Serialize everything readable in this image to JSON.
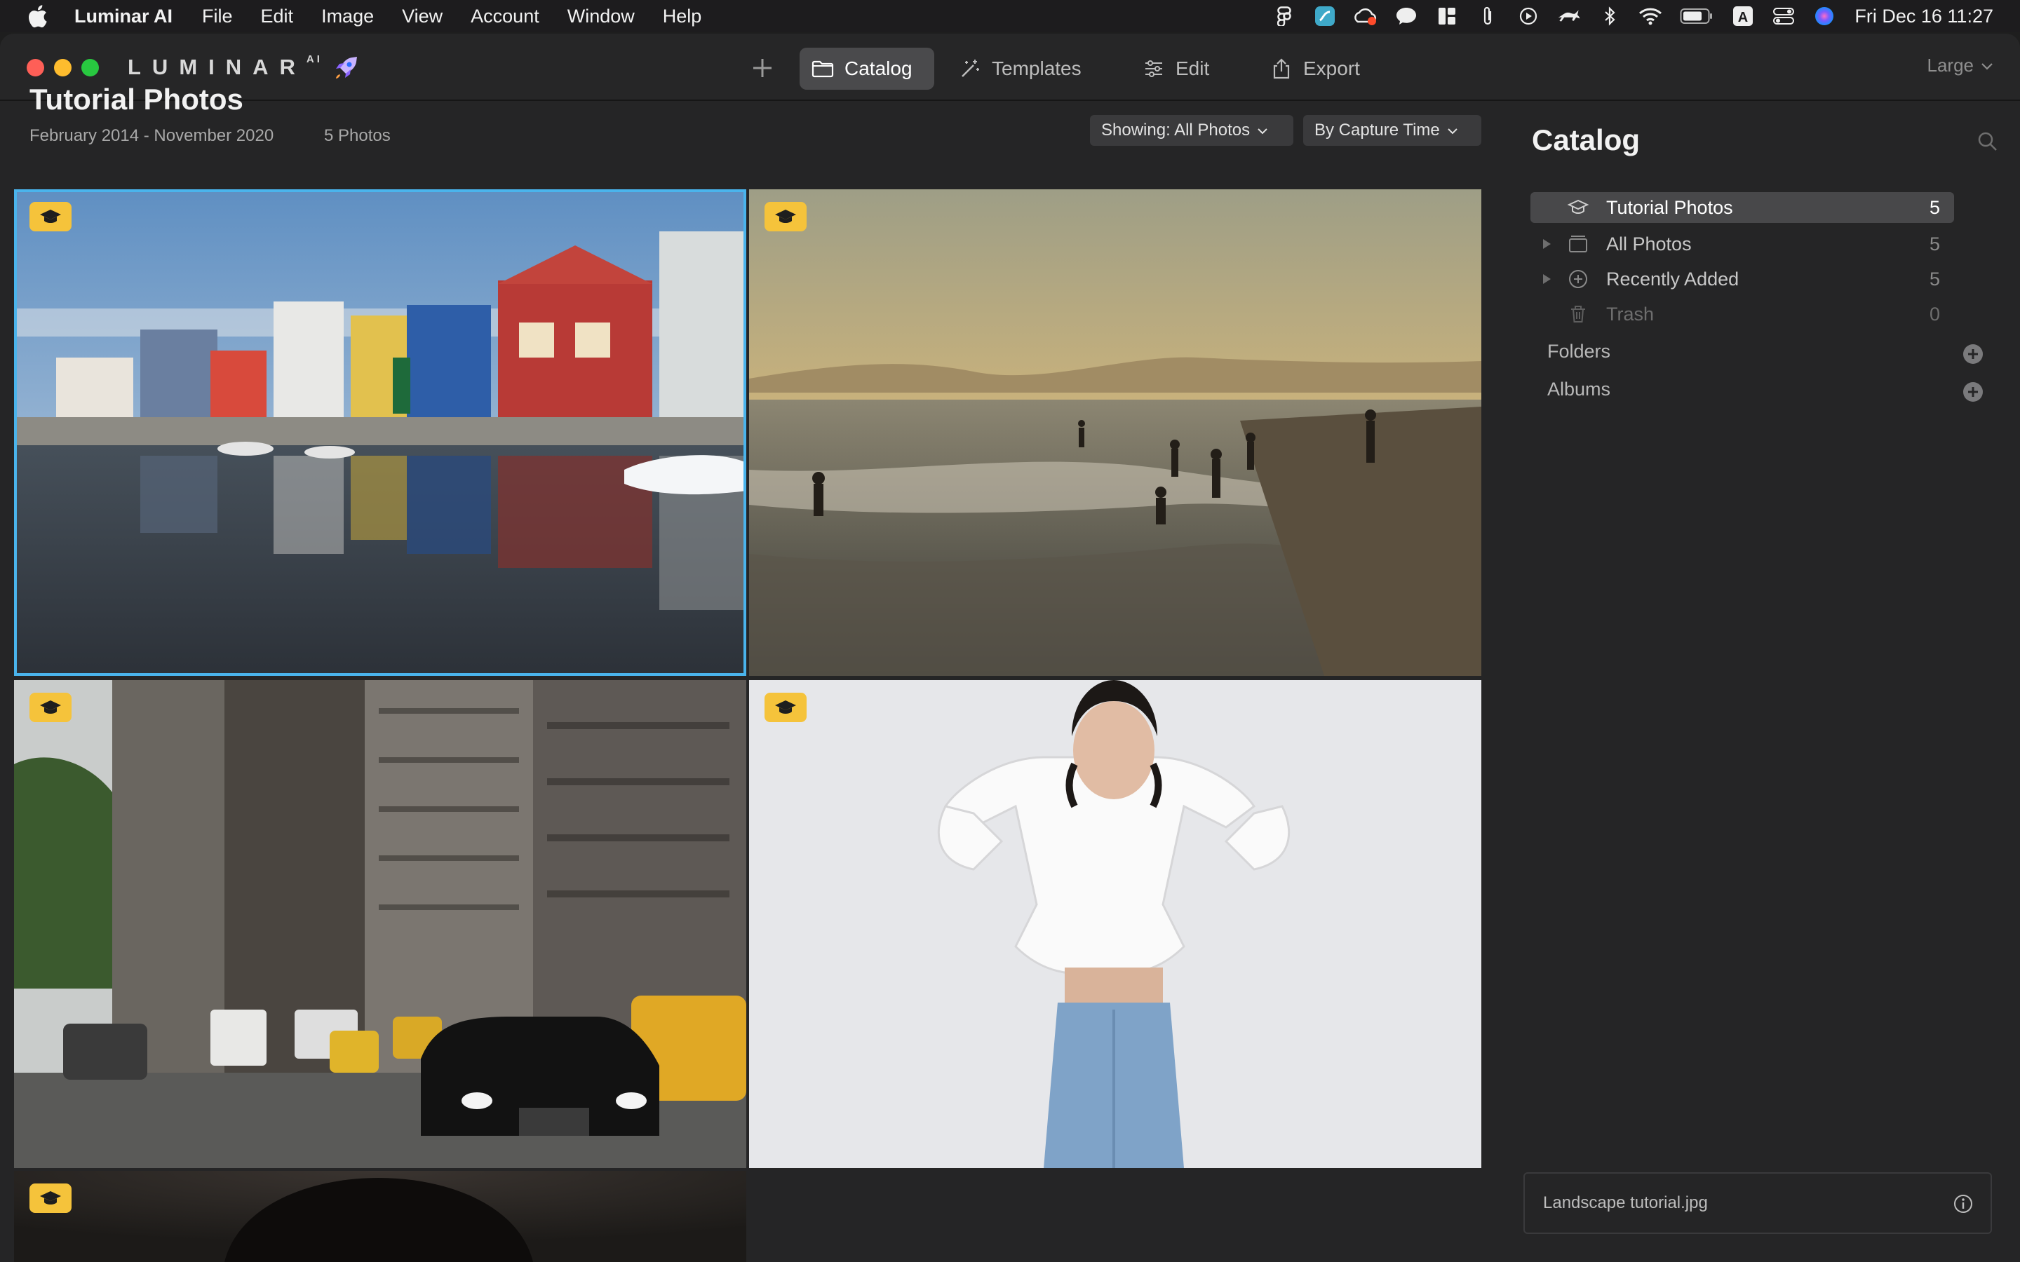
{
  "menubar": {
    "app_name": "Luminar AI",
    "menus": [
      "File",
      "Edit",
      "Image",
      "View",
      "Account",
      "Window",
      "Help"
    ],
    "clock": "Fri Dec 16  11:27",
    "keyboard_input": "A"
  },
  "toolbar": {
    "logo": "LUMINAR",
    "logo_sup": "AI",
    "tabs": {
      "catalog": "Catalog",
      "templates": "Templates",
      "edit": "Edit",
      "export": "Export"
    },
    "size": "Large"
  },
  "header": {
    "title": "Tutorial Photos",
    "date_range": "February 2014 - November 2020",
    "count": "5 Photos",
    "showing": "Showing: All Photos",
    "sort": "By Capture Time"
  },
  "panel": {
    "title": "Catalog",
    "items": {
      "tutorial": {
        "label": "Tutorial Photos",
        "count": "5"
      },
      "all": {
        "label": "All Photos",
        "count": "5"
      },
      "recent": {
        "label": "Recently Added",
        "count": "5"
      },
      "trash": {
        "label": "Trash",
        "count": "0"
      }
    },
    "folders": "Folders",
    "albums": "Albums",
    "file_name": "Landscape tutorial.jpg"
  },
  "colors": {
    "accent_selection": "#4ab4ec",
    "badge": "#f5c33b",
    "background": "#252526"
  }
}
